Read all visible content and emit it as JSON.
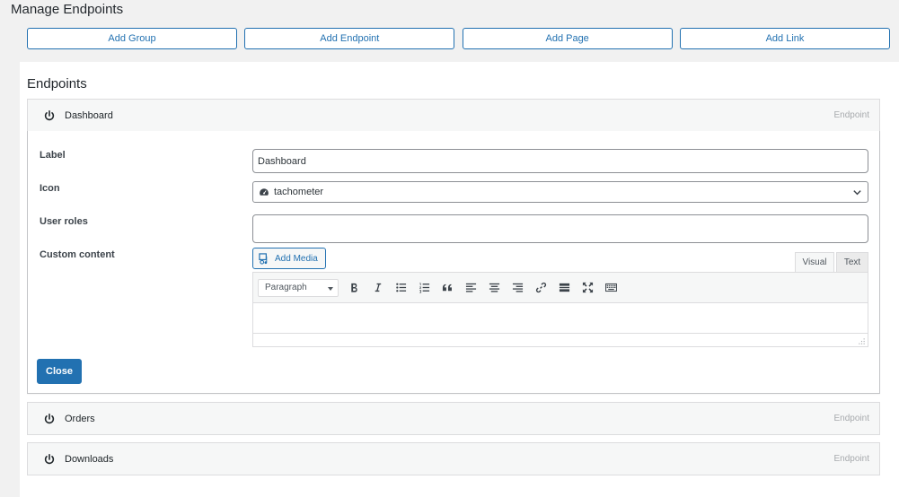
{
  "page_title": "Manage Endpoints",
  "actions": {
    "add_group": "Add Group",
    "add_endpoint": "Add Endpoint",
    "add_page": "Add Page",
    "add_link": "Add Link"
  },
  "endpoints_section": {
    "title": "Endpoints",
    "items": [
      {
        "label": "Dashboard",
        "type": "Endpoint",
        "expanded": true
      },
      {
        "label": "Orders",
        "type": "Endpoint",
        "expanded": false
      },
      {
        "label": "Downloads",
        "type": "Endpoint",
        "expanded": false
      }
    ]
  },
  "form": {
    "label_label": "Label",
    "label_value": "Dashboard",
    "icon_label": "Icon",
    "icon_value": "tachometer",
    "user_roles_label": "User roles",
    "user_roles_value": "",
    "custom_content_label": "Custom content",
    "add_media": "Add Media",
    "tab_visual": "Visual",
    "tab_text": "Text",
    "format_select": "Paragraph",
    "close": "Close"
  },
  "colors": {
    "accent": "#2271b1",
    "header_bg": "#f6f7f7",
    "page_bg": "#f1f1f1"
  }
}
